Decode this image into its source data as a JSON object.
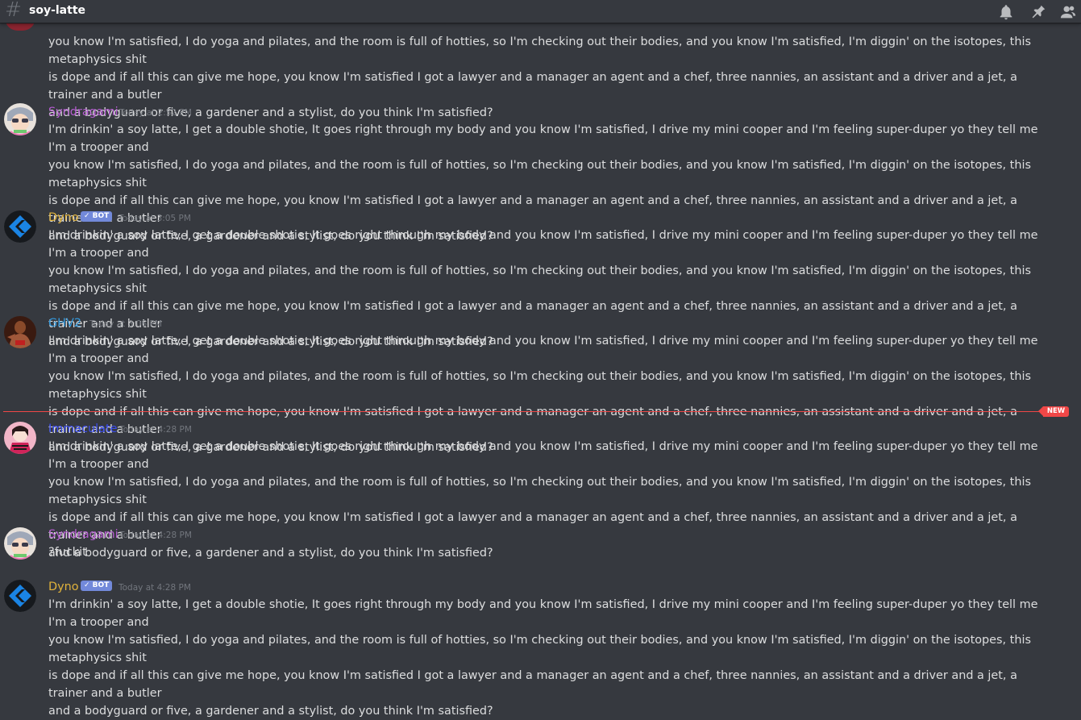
{
  "channel": {
    "name": "soy-latte"
  },
  "new_label": "NEW",
  "bot_label": "✓ BOT",
  "continuation_text": "you know I'm satisfied, I do yoga and pilates, and the room is full of hotties, so I'm checking out their bodies, and you know I'm satisfied, I'm diggin' on the isotopes, this metaphysics shit\nis dope and if all this can give me hope, you know I'm satisfied I got a lawyer and a manager an agent and a chef, three nannies, an assistant and a driver and a jet, a trainer and a butler\nand a bodyguard or five, a gardener and a stylist, do you think I'm satisfied?",
  "messages": [
    {
      "author": "Syndragami",
      "color": "#b65dd1",
      "time": "Today at 2:52 PM",
      "bot": false,
      "avatar": "anime-avatar",
      "text": "I'm drinkin' a soy latte, I get a double shotie, It goes right through my body and you know I'm satisfied, I drive my mini cooper and I'm feeling super-duper yo they tell me I'm a trooper and\nyou know I'm satisfied, I do yoga and pilates, and the room is full of hotties, so I'm checking out their bodies, and you know I'm satisfied, I'm diggin' on the isotopes, this metaphysics shit\nis dope and if all this can give me hope, you know I'm satisfied I got a lawyer and a manager an agent and a chef, three nannies, an assistant and a driver and a jet, a trainer and a butler\nand a bodyguard or five, a gardener and a stylist, do you think I'm satisfied?"
    },
    {
      "author": "Dyno",
      "color": "#e0b23b",
      "time": "Today at 3:05 PM",
      "bot": true,
      "avatar": "dyno-logo",
      "text": "I'm drinkin' a soy latte, I get a double shotie, It goes right through my body and you know I'm satisfied, I drive my mini cooper and I'm feeling super-duper yo they tell me I'm a trooper and\nyou know I'm satisfied, I do yoga and pilates, and the room is full of hotties, so I'm checking out their bodies, and you know I'm satisfied, I'm diggin' on the isotopes, this metaphysics shit\nis dope and if all this can give me hope, you know I'm satisfied I got a lawyer and a manager an agent and a chef, three nannies, an assistant and a driver and a jet, a trainer and a butler\nand a bodyguard or five, a gardener and a stylist, do you think I'm satisfied?"
    },
    {
      "author": "GHV2",
      "color": "#3498db",
      "time": "Today at 3:06 PM",
      "bot": false,
      "avatar": "photo-avatar",
      "text": "I'm drinkin' a soy latte, I get a double shotie, It goes right through my body and you know I'm satisfied, I drive my mini cooper and I'm feeling super-duper yo they tell me I'm a trooper and\nyou know I'm satisfied, I do yoga and pilates, and the room is full of hotties, so I'm checking out their bodies, and you know I'm satisfied, I'm diggin' on the isotopes, this metaphysics shit\nis dope and if all this can give me hope, you know I'm satisfied I got a lawyer and a manager an agent and a chef, three nannies, an assistant and a driver and a jet, a trainer and a butler\nand a bodyguard or five, a gardener and a stylist, do you think I'm satisfied?"
    },
    {
      "author": "Immaculate",
      "color": "#3a4cf0",
      "time": "Today at 4:28 PM",
      "bot": false,
      "avatar": "pink-avatar",
      "text": "I'm drinkin' a soy latte, I get a double shotie, It goes right through my body and you know I'm satisfied, I drive my mini cooper and I'm feeling super-duper yo they tell me I'm a trooper and\nyou know I'm satisfied, I do yoga and pilates, and the room is full of hotties, so I'm checking out their bodies, and you know I'm satisfied, I'm diggin' on the isotopes, this metaphysics shit\nis dope and if all this can give me hope, you know I'm satisfied I got a lawyer and a manager an agent and a chef, three nannies, an assistant and a driver and a jet, a trainer and a butler\nand a bodyguard or five, a gardener and a stylist, do you think I'm satisfied?"
    },
    {
      "author": "Syndragami",
      "color": "#b65dd1",
      "time": "Today at 4:28 PM",
      "bot": false,
      "avatar": "anime-avatar",
      "text": "?fuckit"
    },
    {
      "author": "Dyno",
      "color": "#e0b23b",
      "time": "Today at 4:28 PM",
      "bot": true,
      "avatar": "dyno-logo",
      "text": "I'm drinkin' a soy latte, I get a double shotie, It goes right through my body and you know I'm satisfied, I drive my mini cooper and I'm feeling super-duper yo they tell me I'm a trooper and\nyou know I'm satisfied, I do yoga and pilates, and the room is full of hotties, so I'm checking out their bodies, and you know I'm satisfied, I'm diggin' on the isotopes, this metaphysics shit\nis dope and if all this can give me hope, you know I'm satisfied I got a lawyer and a manager an agent and a chef, three nannies, an assistant and a driver and a jet, a trainer and a butler\nand a bodyguard or five, a gardener and a stylist, do you think I'm satisfied?"
    }
  ]
}
